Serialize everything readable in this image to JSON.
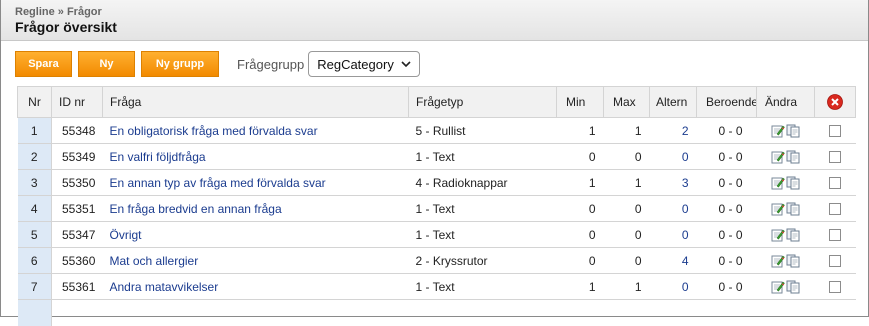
{
  "breadcrumb": "Regline » Frågor",
  "page_title": "Frågor översikt",
  "toolbar": {
    "save_label": "Spara",
    "new_label": "Ny",
    "new_group_label": "Ny grupp",
    "group_label": "Frågegrupp",
    "group_value": "RegCategory"
  },
  "columns": {
    "nr": "Nr",
    "id": "ID nr",
    "question": "Fråga",
    "type": "Frågetyp",
    "min": "Min",
    "max": "Max",
    "altern": "Altern",
    "dependent": "Beroende",
    "edit": "Ändra"
  },
  "rows": [
    {
      "nr": "1",
      "id": "55348",
      "question": "En obligatorisk fråga med förvalda svar",
      "type": "5 - Rullist",
      "min": "1",
      "max": "1",
      "altern": "2",
      "dep": "0 - 0"
    },
    {
      "nr": "2",
      "id": "55349",
      "question": "En valfri följdfråga",
      "type": "1 - Text",
      "min": "0",
      "max": "0",
      "altern": "0",
      "dep": "0 - 0"
    },
    {
      "nr": "3",
      "id": "55350",
      "question": "En annan typ av fråga med förvalda svar",
      "type": "4 - Radioknappar",
      "min": "1",
      "max": "1",
      "altern": "3",
      "dep": "0 - 0"
    },
    {
      "nr": "4",
      "id": "55351",
      "question": "En fråga bredvid en annan fråga",
      "type": "1 - Text",
      "min": "0",
      "max": "0",
      "altern": "0",
      "dep": "0 - 0"
    },
    {
      "nr": "5",
      "id": "55347",
      "question": "Övrigt",
      "type": "1 - Text",
      "min": "0",
      "max": "0",
      "altern": "0",
      "dep": "0 - 0"
    },
    {
      "nr": "6",
      "id": "55360",
      "question": "Mat och allergier",
      "type": "2 - Kryssrutor",
      "min": "0",
      "max": "0",
      "altern": "4",
      "dep": "0 - 0"
    },
    {
      "nr": "7",
      "id": "55361",
      "question": "Andra matavvikelser",
      "type": "1 - Text",
      "min": "1",
      "max": "1",
      "altern": "0",
      "dep": "0 - 0"
    }
  ],
  "colors": {
    "button_orange": "#f7a020",
    "link_blue": "#1b3c8f",
    "nr_cell_bg": "#dde9f6",
    "delete_red": "#d9281e"
  }
}
